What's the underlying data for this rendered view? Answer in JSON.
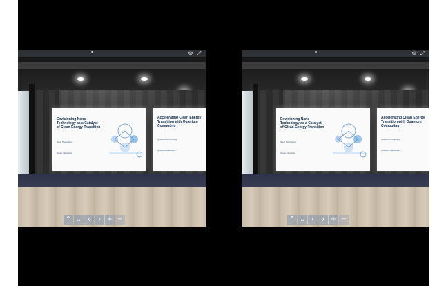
{
  "frame": {
    "background": "#ffffff",
    "video_background": "#000000"
  },
  "eyes": [
    {
      "id": "left",
      "posters": {
        "main": {
          "title": "Envisioning Nano Technology as a Catalyst of Clean Energy Transition",
          "subtitle": "Nano Technology",
          "note": "Green Industries"
        },
        "side": {
          "title": "Accelerating Clean Energy Transition with Quantum Computing",
          "subtitle": "Quantum Computing",
          "note": "Quantum Industries"
        }
      },
      "controls": {
        "top_icons": [
          "settings-icon",
          "fullscreen-icon"
        ],
        "nav_buttons": [
          "up-icon",
          "down-icon",
          "left-icon",
          "right-icon",
          "zoom-in-icon",
          "zoom-out-icon"
        ]
      }
    },
    {
      "id": "right",
      "posters": {
        "main": {
          "title": "Envisioning Nano Technology as a Catalyst of Clean Energy Transition",
          "subtitle": "Nano Technology",
          "note": "Green Industries"
        },
        "side": {
          "title": "Accelerating Clean Energy Transition with Quantum Computing",
          "subtitle": "Quantum Computing",
          "note": "Quantum Industries"
        }
      },
      "controls": {
        "top_icons": [
          "settings-icon",
          "fullscreen-icon"
        ],
        "nav_buttons": [
          "up-icon",
          "down-icon",
          "left-icon",
          "right-icon",
          "zoom-in-icon",
          "zoom-out-icon"
        ]
      }
    }
  ],
  "glyphs": {
    "up": "⌃",
    "down": "⌄",
    "left": "‹",
    "right": "›",
    "zoom_in": "+",
    "zoom_out": "−",
    "settings": "⚙",
    "fullscreen": "⤢"
  }
}
